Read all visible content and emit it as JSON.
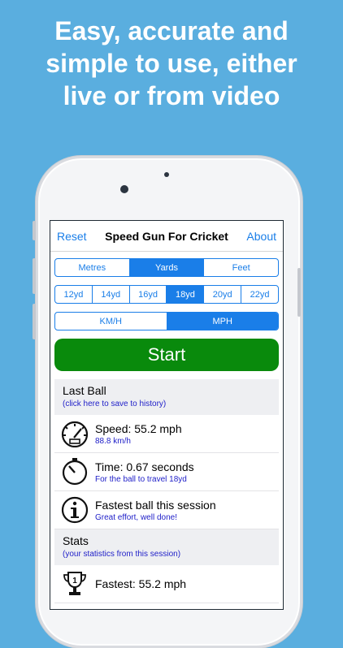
{
  "headline": {
    "line1": "Easy, accurate and",
    "line2": "simple to use, either",
    "line3": "live or from video"
  },
  "navbar": {
    "left": "Reset",
    "title": "Speed Gun For Cricket",
    "right": "About"
  },
  "units": {
    "options": [
      "Metres",
      "Yards",
      "Feet"
    ],
    "selected": "Yards"
  },
  "distances": {
    "options": [
      "12yd",
      "14yd",
      "16yd",
      "18yd",
      "20yd",
      "22yd"
    ],
    "selected": "18yd"
  },
  "speed_units": {
    "options": [
      "KM/H",
      "MPH"
    ],
    "selected": "MPH"
  },
  "start_label": "Start",
  "last_ball": {
    "title": "Last Ball",
    "subtitle": "(click here to save to history)",
    "rows": [
      {
        "icon": "speedometer-icon",
        "main": "Speed: 55.2 mph",
        "sub": "88.8 km/h"
      },
      {
        "icon": "stopwatch-icon",
        "main": "Time: 0.67 seconds",
        "sub": "For the ball to travel 18yd"
      },
      {
        "icon": "info-icon",
        "main": "Fastest ball this session",
        "sub": "Great effort, well done!"
      }
    ]
  },
  "stats": {
    "title": "Stats",
    "subtitle": "(your statistics from this session)",
    "rows": [
      {
        "icon": "trophy-icon",
        "main": "Fastest: 55.2 mph"
      }
    ]
  },
  "colors": {
    "background": "#5aaedf",
    "accent": "#1a7ee8",
    "start": "#098a0c",
    "subtext": "#1e1ec8"
  }
}
